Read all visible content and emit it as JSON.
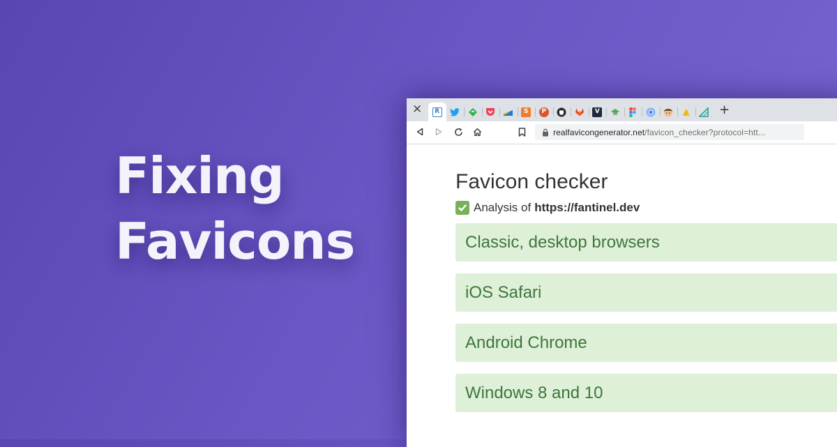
{
  "hero": {
    "line1": "Fixing",
    "line2": "Favicons"
  },
  "browser": {
    "close_label": "✕",
    "new_tab_label": "+",
    "tabs": [
      {
        "icon": "realfavicongenerator-icon",
        "glyph": "R",
        "color": "#3b82c4"
      },
      {
        "icon": "twitter-icon",
        "glyph": "",
        "color": "#1da1f2"
      },
      {
        "icon": "feedly-icon",
        "glyph": "",
        "color": "#2bb24c"
      },
      {
        "icon": "pocket-icon",
        "glyph": "",
        "color": "#ef4056"
      },
      {
        "icon": "stack-icon",
        "glyph": "",
        "color": "#1f7bd1"
      },
      {
        "icon": "s-brand-icon",
        "glyph": "S",
        "color": "#f07c2f"
      },
      {
        "icon": "producthunt-icon",
        "glyph": "P",
        "color": "#da552f"
      },
      {
        "icon": "github-icon",
        "glyph": "",
        "color": "#24292e"
      },
      {
        "icon": "gitlab-icon",
        "glyph": "",
        "color": "#e24329"
      },
      {
        "icon": "v-brand-icon",
        "glyph": "V",
        "color": "#1e2a3a"
      },
      {
        "icon": "hat-icon",
        "glyph": "",
        "color": "#4caf50"
      },
      {
        "icon": "figma-icon",
        "glyph": "",
        "color": "#f24e1e"
      },
      {
        "icon": "chromium-icon",
        "glyph": "",
        "color": "#4285f4"
      },
      {
        "icon": "avatar-face-icon",
        "glyph": "",
        "color": "#c98b5a"
      },
      {
        "icon": "yellow-brand-icon",
        "glyph": "",
        "color": "#f4b400"
      },
      {
        "icon": "triangle-ruler-icon",
        "glyph": "",
        "color": "#26a69a"
      }
    ],
    "url": {
      "host": "realfavicongenerator.net",
      "path": "/favicon_checker?protocol=htt..."
    }
  },
  "page": {
    "title": "Favicon checker",
    "analysis_prefix": "Analysis of",
    "analysis_target": "https://fantinel.dev",
    "sections": [
      "Classic, desktop browsers",
      "iOS Safari",
      "Android Chrome",
      "Windows 8 and 10"
    ]
  },
  "colors": {
    "background_start": "#5a46b2",
    "background_end": "#7b67d2",
    "panel_bg": "#dff0d8",
    "panel_text": "#3c763d",
    "check": "#78b159"
  }
}
